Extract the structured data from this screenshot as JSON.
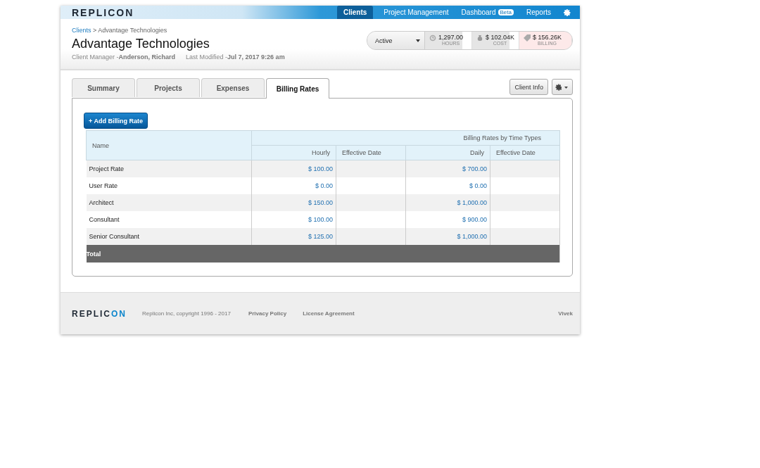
{
  "logo": {
    "main": "REPLIC",
    "accent": "ON"
  },
  "nav": [
    {
      "label": "Clients",
      "selected": true
    },
    {
      "label": "Project Management",
      "selected": false
    },
    {
      "label": "Dashboard",
      "badge": "Beta",
      "selected": false
    },
    {
      "label": "Reports",
      "selected": false
    }
  ],
  "breadcrumb": {
    "link": "Clients",
    "separator": ">",
    "current": "Advantage Technologies"
  },
  "title": "Advantage Technologies",
  "meta": [
    {
      "label": "Client Manager -",
      "value": "Anderson, Richard"
    },
    {
      "label": "Last Modified -",
      "value": "Jul 7, 2017 9:26 am"
    }
  ],
  "status": {
    "value": "Active"
  },
  "stats": [
    {
      "kind": "hours",
      "value": "1,297.00",
      "label": "HOURS"
    },
    {
      "kind": "cost",
      "value": "$ 102.04K",
      "label": "COST"
    },
    {
      "kind": "billing",
      "value": "$ 156.26K",
      "label": "BILLING"
    }
  ],
  "tabs": [
    {
      "label": "Summary",
      "selected": false
    },
    {
      "label": "Projects",
      "selected": false
    },
    {
      "label": "Expenses",
      "selected": false
    },
    {
      "label": "Billing Rates",
      "selected": true
    }
  ],
  "client_info_button": "Client Info",
  "add_button": "+ Add Billing Rate",
  "table": {
    "name_header": "Name",
    "group_header": "Billing Rates by Time Types",
    "columns": [
      "Hourly",
      "Effective Date",
      "Daily",
      "Effective Date"
    ],
    "rows": [
      {
        "name": "Project Rate",
        "hourly": "$ 100.00",
        "daily": "$ 700.00"
      },
      {
        "name": "User Rate",
        "hourly": "$ 0.00",
        "daily": "$ 0.00"
      },
      {
        "name": "Architect",
        "hourly": "$ 150.00",
        "daily": "$ 1,000.00"
      },
      {
        "name": "Consultant",
        "hourly": "$ 100.00",
        "daily": "$ 900.00"
      },
      {
        "name": "Senior Consultant",
        "hourly": "$ 125.00",
        "daily": "$ 1,000.00"
      }
    ],
    "total": "Total"
  },
  "footer": {
    "logo": {
      "main": "REPLIC",
      "accent": "ON"
    },
    "copyright": "Replicon Inc, copyright 1996 - 2017",
    "links": [
      "Privacy Policy",
      "License Agreement"
    ],
    "user": "Vivek"
  }
}
